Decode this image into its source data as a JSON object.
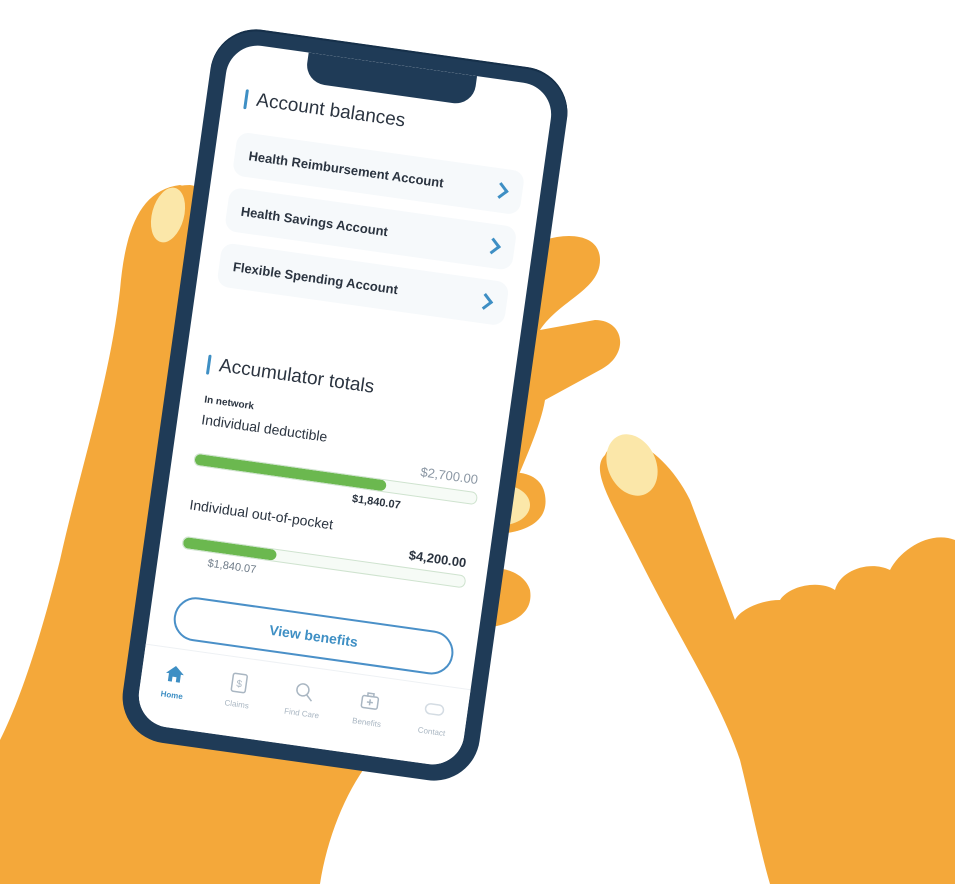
{
  "account_balances": {
    "title": "Account balances",
    "items": [
      {
        "label": "Health Reimbursement Account"
      },
      {
        "label": "Health Savings Account"
      },
      {
        "label": "Flexible Spending Account"
      }
    ]
  },
  "accumulator": {
    "title": "Accumulator totals",
    "network": "In network",
    "items": [
      {
        "label": "Individual deductible",
        "total": "$2,700.00",
        "used": "$1,840.07",
        "progress": 0.68
      },
      {
        "label": "Individual out-of-pocket",
        "total": "$4,200.00",
        "used": "$1,840.07",
        "progress": 0.33
      }
    ]
  },
  "view_benefits": "View benefits",
  "tabs": [
    {
      "label": "Home",
      "icon": "home-icon",
      "active": true
    },
    {
      "label": "Claims",
      "icon": "claims-icon"
    },
    {
      "label": "Find Care",
      "icon": "search-icon"
    },
    {
      "label": "Benefits",
      "icon": "medical-kit-icon"
    },
    {
      "label": "Contact",
      "icon": "chat-icon"
    }
  ],
  "colors": {
    "accent": "#3e8fc4",
    "progress": "#6bb84f",
    "phone_frame": "#1f3b57",
    "skin": "#f4a83a",
    "fingernail": "#fbe7a9"
  }
}
